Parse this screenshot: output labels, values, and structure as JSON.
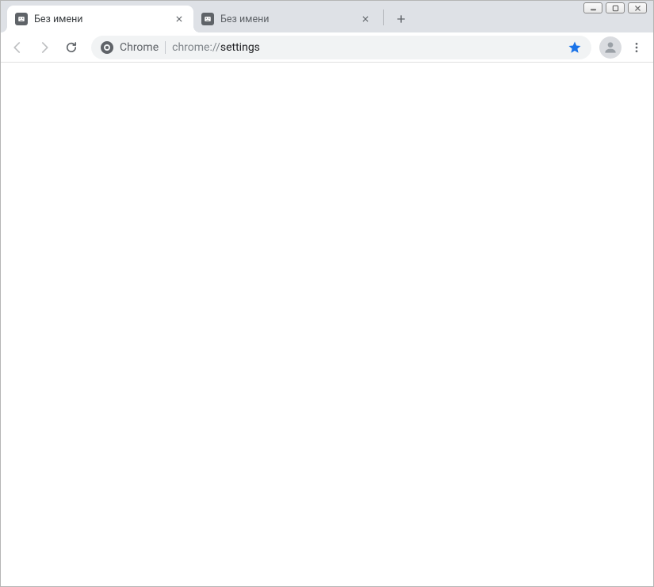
{
  "window": {
    "minimize": "⎯",
    "maximize": "▢",
    "close": "✕"
  },
  "tabs": [
    {
      "title": "Без имени",
      "active": true
    },
    {
      "title": "Без имени",
      "active": false
    }
  ],
  "omnibox": {
    "label": "Chrome",
    "url_prefix": "chrome://",
    "url_path": "settings"
  }
}
